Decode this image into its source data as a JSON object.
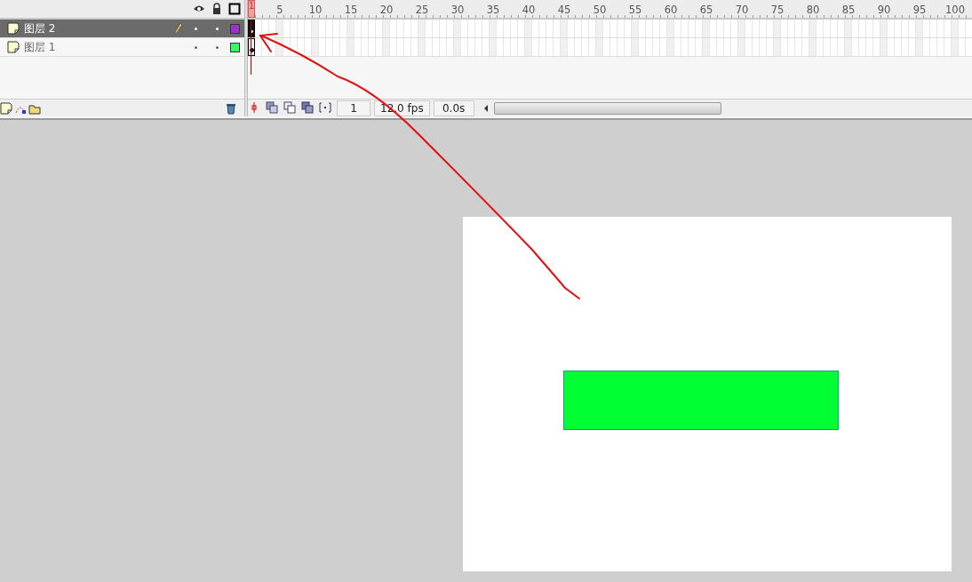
{
  "timeline": {
    "ruler_labels": [
      "1",
      "5",
      "10",
      "15",
      "20",
      "25",
      "30",
      "35",
      "40",
      "45",
      "50",
      "55",
      "60",
      "65",
      "70",
      "75",
      "80",
      "85",
      "90",
      "95",
      "100"
    ],
    "layers": [
      {
        "name": "图层 2",
        "selected": true,
        "editing": true,
        "color": "#9933cc",
        "empty_keyframe": true
      },
      {
        "name": "图层 1",
        "selected": false,
        "editing": false,
        "color": "#33ff66",
        "empty_keyframe": false
      }
    ],
    "current_frame": "1",
    "frame_rate": "12.0 fps",
    "elapsed_time": "0.0s"
  }
}
